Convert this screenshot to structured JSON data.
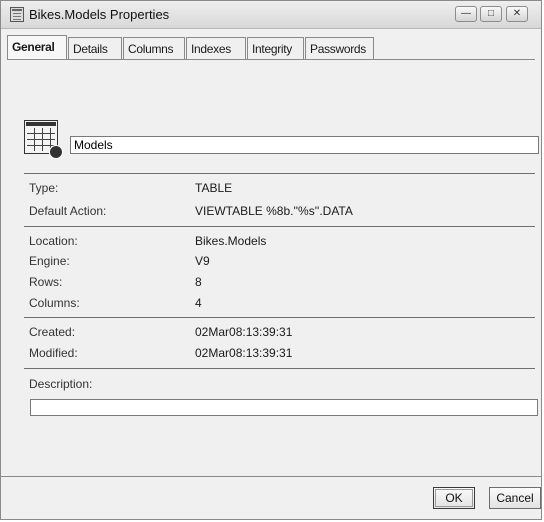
{
  "window": {
    "title": "Bikes.Models Properties",
    "controls": {
      "minimize": "—",
      "maximize": "□",
      "close": "✕"
    }
  },
  "tabs": [
    {
      "label": "General",
      "active": true
    },
    {
      "label": "Details",
      "active": false
    },
    {
      "label": "Columns",
      "active": false
    },
    {
      "label": "Indexes",
      "active": false
    },
    {
      "label": "Integrity",
      "active": false
    },
    {
      "label": "Passwords",
      "active": false
    }
  ],
  "general": {
    "name_value": "Models",
    "type": {
      "label": "Type:",
      "value": "TABLE"
    },
    "default_action": {
      "label": "Default Action:",
      "value": "VIEWTABLE %8b.''%s''.DATA"
    },
    "location": {
      "label": "Location:",
      "value": "Bikes.Models"
    },
    "engine": {
      "label": "Engine:",
      "value": "V9"
    },
    "rows": {
      "label": "Rows:",
      "value": "8"
    },
    "columns": {
      "label": "Columns:",
      "value": "4"
    },
    "created": {
      "label": "Created:",
      "value": "02Mar08:13:39:31"
    },
    "modified": {
      "label": "Modified:",
      "value": "02Mar08:13:39:31"
    },
    "description": {
      "label": "Description:",
      "value": ""
    }
  },
  "buttons": {
    "ok": "OK",
    "cancel": "Cancel"
  },
  "icons": {
    "app": "table-icon",
    "object": "data-table-icon"
  }
}
